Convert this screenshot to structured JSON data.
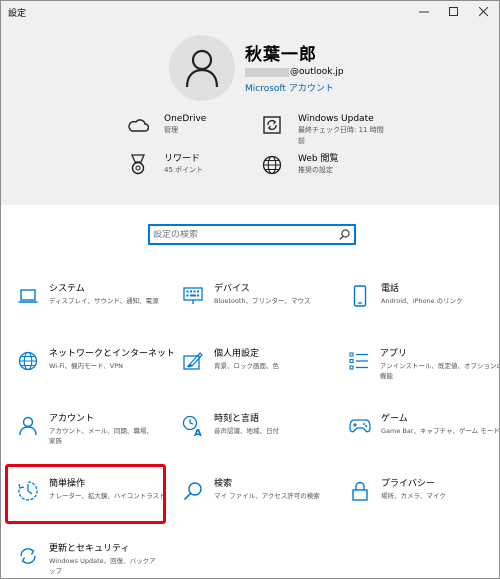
{
  "window": {
    "title": "設定"
  },
  "account": {
    "name": "秋葉一郎",
    "email_suffix": "@outlook.jp",
    "ms_account_link": "Microsoft アカウント"
  },
  "quick": [
    {
      "title": "OneDrive",
      "sub": "管理",
      "icon": "cloud-icon"
    },
    {
      "title": "Windows Update",
      "sub": "最終チェック日時: 11 時間前",
      "icon": "update-icon"
    },
    {
      "title": "リワード",
      "sub": "45 ポイント",
      "icon": "medal-icon"
    },
    {
      "title": "Web 閲覧",
      "sub": "推奨の設定",
      "icon": "globe-icon"
    }
  ],
  "search": {
    "placeholder": "設定の検索"
  },
  "tiles": [
    {
      "title": "システム",
      "sub": "ディスプレイ、サウンド、通知、電源",
      "icon": "laptop-icon"
    },
    {
      "title": "デバイス",
      "sub": "Bluetooth、プリンター、マウス",
      "icon": "keyboard-icon"
    },
    {
      "title": "電話",
      "sub": "Android、iPhone のリンク",
      "icon": "phone-icon"
    },
    {
      "title": "ネットワークとインターネット",
      "sub": "Wi-Fi、機内モード、VPN",
      "icon": "globe-icon"
    },
    {
      "title": "個人用設定",
      "sub": "背景、ロック画面、色",
      "icon": "paint-icon"
    },
    {
      "title": "アプリ",
      "sub": "アンインストール、既定値、オプションの機能",
      "icon": "apps-list-icon"
    },
    {
      "title": "アカウント",
      "sub": "アカウント、メール、同期、職場、家族",
      "icon": "person-icon"
    },
    {
      "title": "時刻と言語",
      "sub": "音声認識、地域、日付",
      "icon": "time-language-icon"
    },
    {
      "title": "ゲーム",
      "sub": "Game Bar、キャプチャ、ゲーム モード",
      "icon": "gamepad-icon"
    },
    {
      "title": "簡単操作",
      "sub": "ナレーター、拡大鏡、ハイコントラスト",
      "icon": "ease-of-access-icon"
    },
    {
      "title": "検索",
      "sub": "マイ ファイル、アクセス許可の検索",
      "icon": "search-icon"
    },
    {
      "title": "プライバシー",
      "sub": "場所、カメラ、マイク",
      "icon": "lock-icon"
    },
    {
      "title": "更新とセキュリティ",
      "sub": "Windows Update、回復、バックアップ",
      "icon": "sync-icon"
    }
  ],
  "colors": {
    "accent": "#0078d7",
    "highlight": "#e60012"
  }
}
